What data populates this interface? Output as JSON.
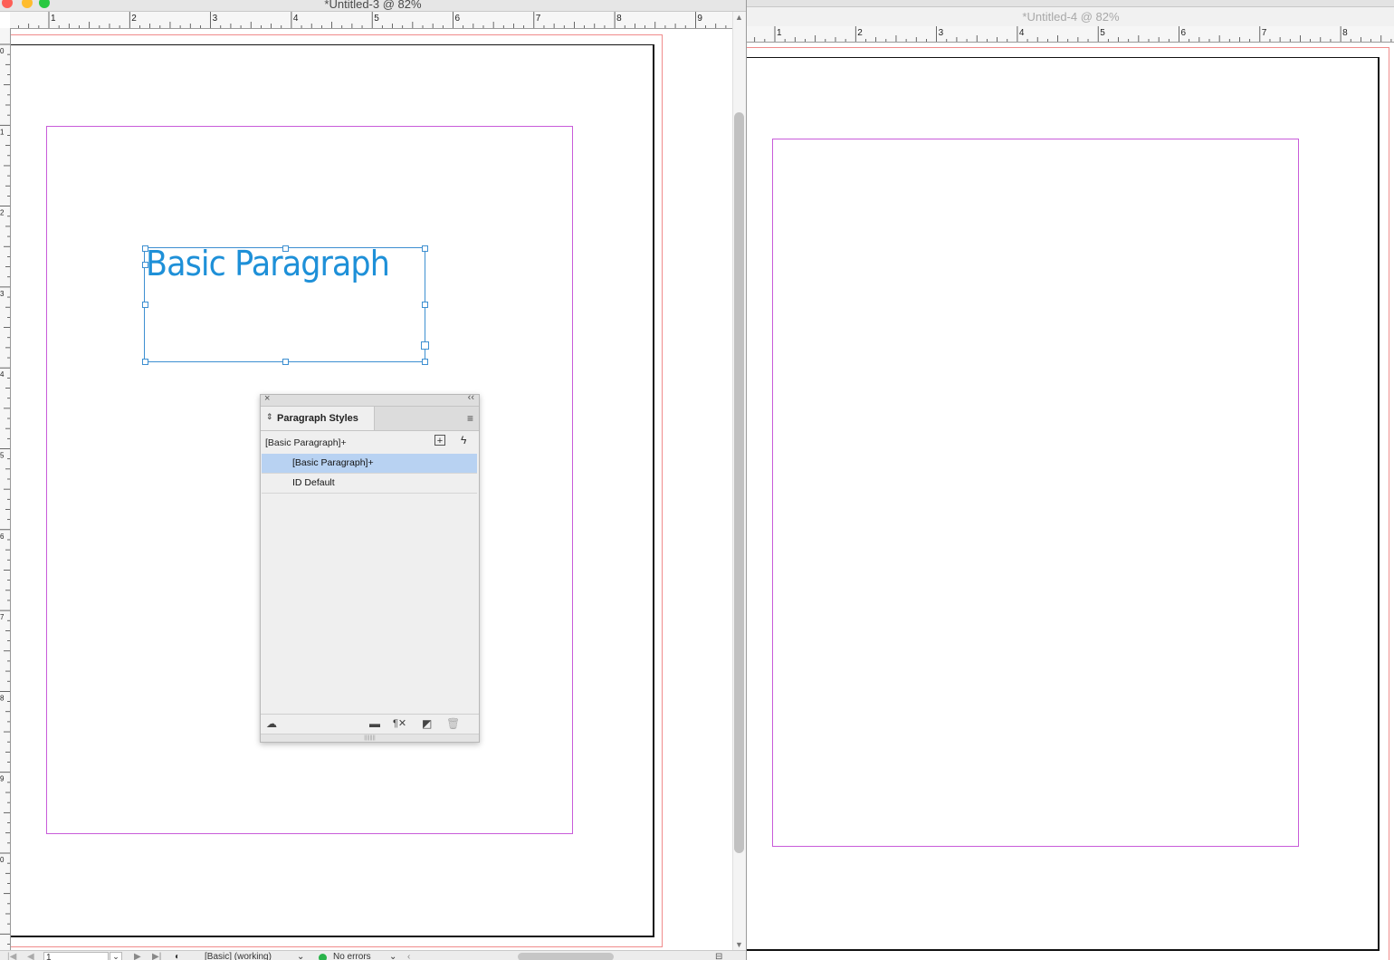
{
  "left_window": {
    "title": "*Untitled-3 @ 82%",
    "h_ruler_numbers": [
      "1",
      "2",
      "3",
      "4",
      "5",
      "6",
      "7",
      "8",
      "9"
    ],
    "v_ruler_numbers": [
      "0",
      "1",
      "2",
      "3",
      "4",
      "5",
      "6",
      "7",
      "8",
      "9",
      "0"
    ],
    "text_frame_content": "Basic Paragraph",
    "status_bar": {
      "page_number": "1",
      "preflight_profile": "[Basic] (working)",
      "preflight_status": "No errors",
      "status_color": "#29b34a"
    }
  },
  "paragraph_styles_panel": {
    "tab_label": "Paragraph Styles",
    "current_style": "[Basic Paragraph]+",
    "styles": [
      {
        "label": "[Basic Paragraph]+",
        "selected": true
      },
      {
        "label": "ID Default",
        "selected": false
      }
    ],
    "footer_icons": [
      "cloud-library-icon",
      "new-group-icon",
      "clear-overrides-icon",
      "new-style-icon",
      "delete-icon"
    ],
    "selection_color": "#b8d2f2"
  },
  "right_window": {
    "title": "*Untitled-4 @ 82%",
    "h_ruler_numbers": [
      "1",
      "2",
      "3",
      "4",
      "5",
      "6",
      "7",
      "8"
    ]
  },
  "colors": {
    "margin_guide": "#c85cd9",
    "bleed_guide": "#f08b8b",
    "frame_text": "#1e90d8",
    "frame_border": "#3d8fd1"
  }
}
